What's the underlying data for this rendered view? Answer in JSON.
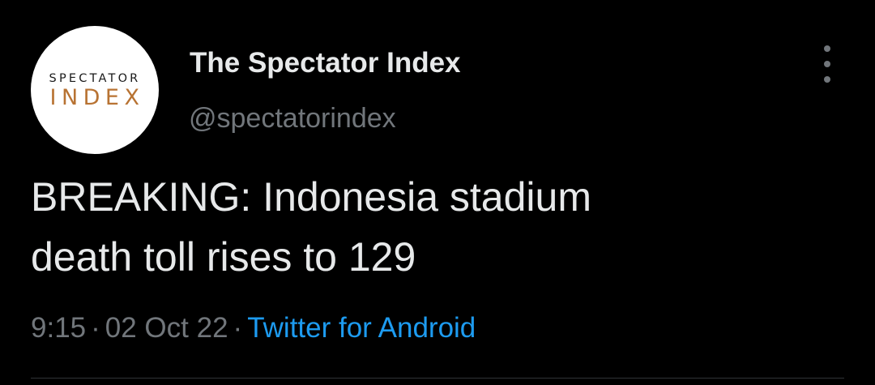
{
  "author": {
    "display_name": "The Spectator Index",
    "handle": "@spectatorindex",
    "avatar_logo_line1": "SPECTATOR",
    "avatar_logo_line2": "INDEX"
  },
  "tweet": {
    "text": "BREAKING: Indonesia stadium\ndeath toll rises to 129",
    "time": "9:15",
    "date": "02 Oct 22",
    "separator": "·",
    "source": "Twitter for Android"
  },
  "icons": {
    "more": "more-vertical-icon"
  },
  "colors": {
    "background": "#000000",
    "primary_text": "#e7e9ea",
    "secondary_text": "#71767b",
    "link": "#1d9bf0",
    "logo_accent": "#b87333"
  }
}
